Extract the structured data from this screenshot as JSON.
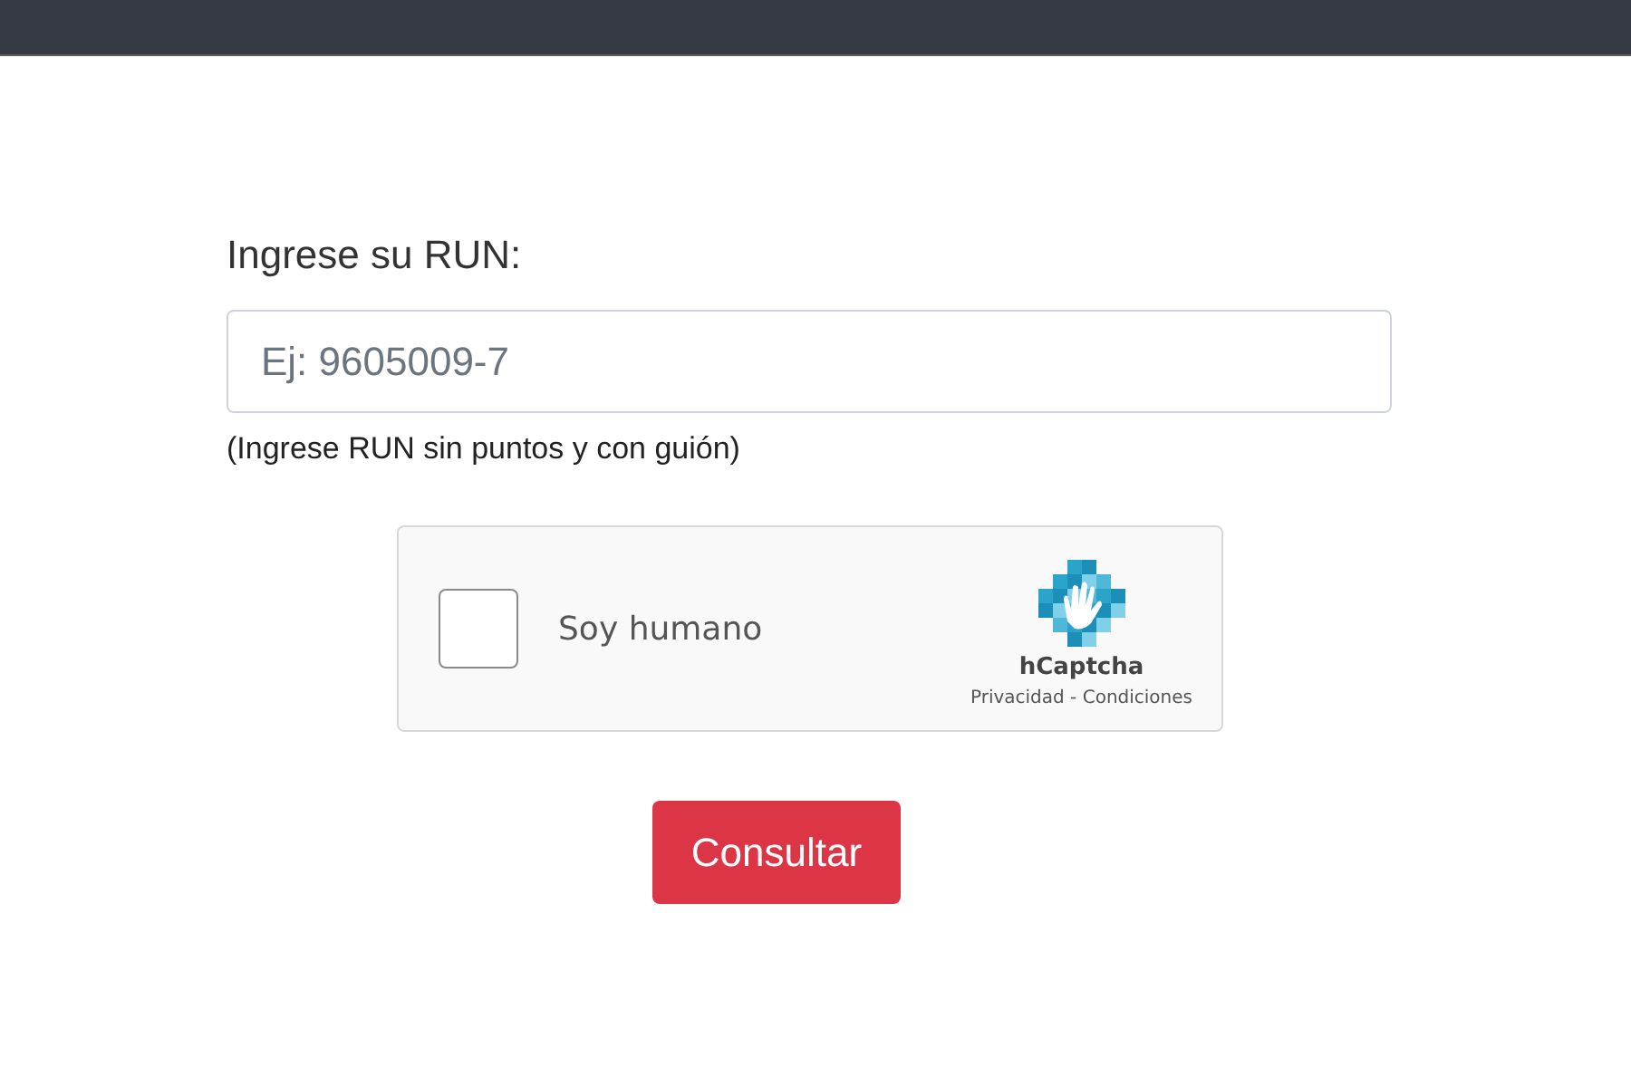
{
  "form": {
    "label": "Ingrese su RUN:",
    "run_field": {
      "placeholder": "Ej: 9605009-7"
    },
    "hint": "(Ingrese RUN sin puntos y con guión)"
  },
  "captcha": {
    "checked": false,
    "label": "Soy humano",
    "brand": "hCaptcha",
    "links": "Privacidad - Condiciones"
  },
  "submit_button": "Consultar"
}
